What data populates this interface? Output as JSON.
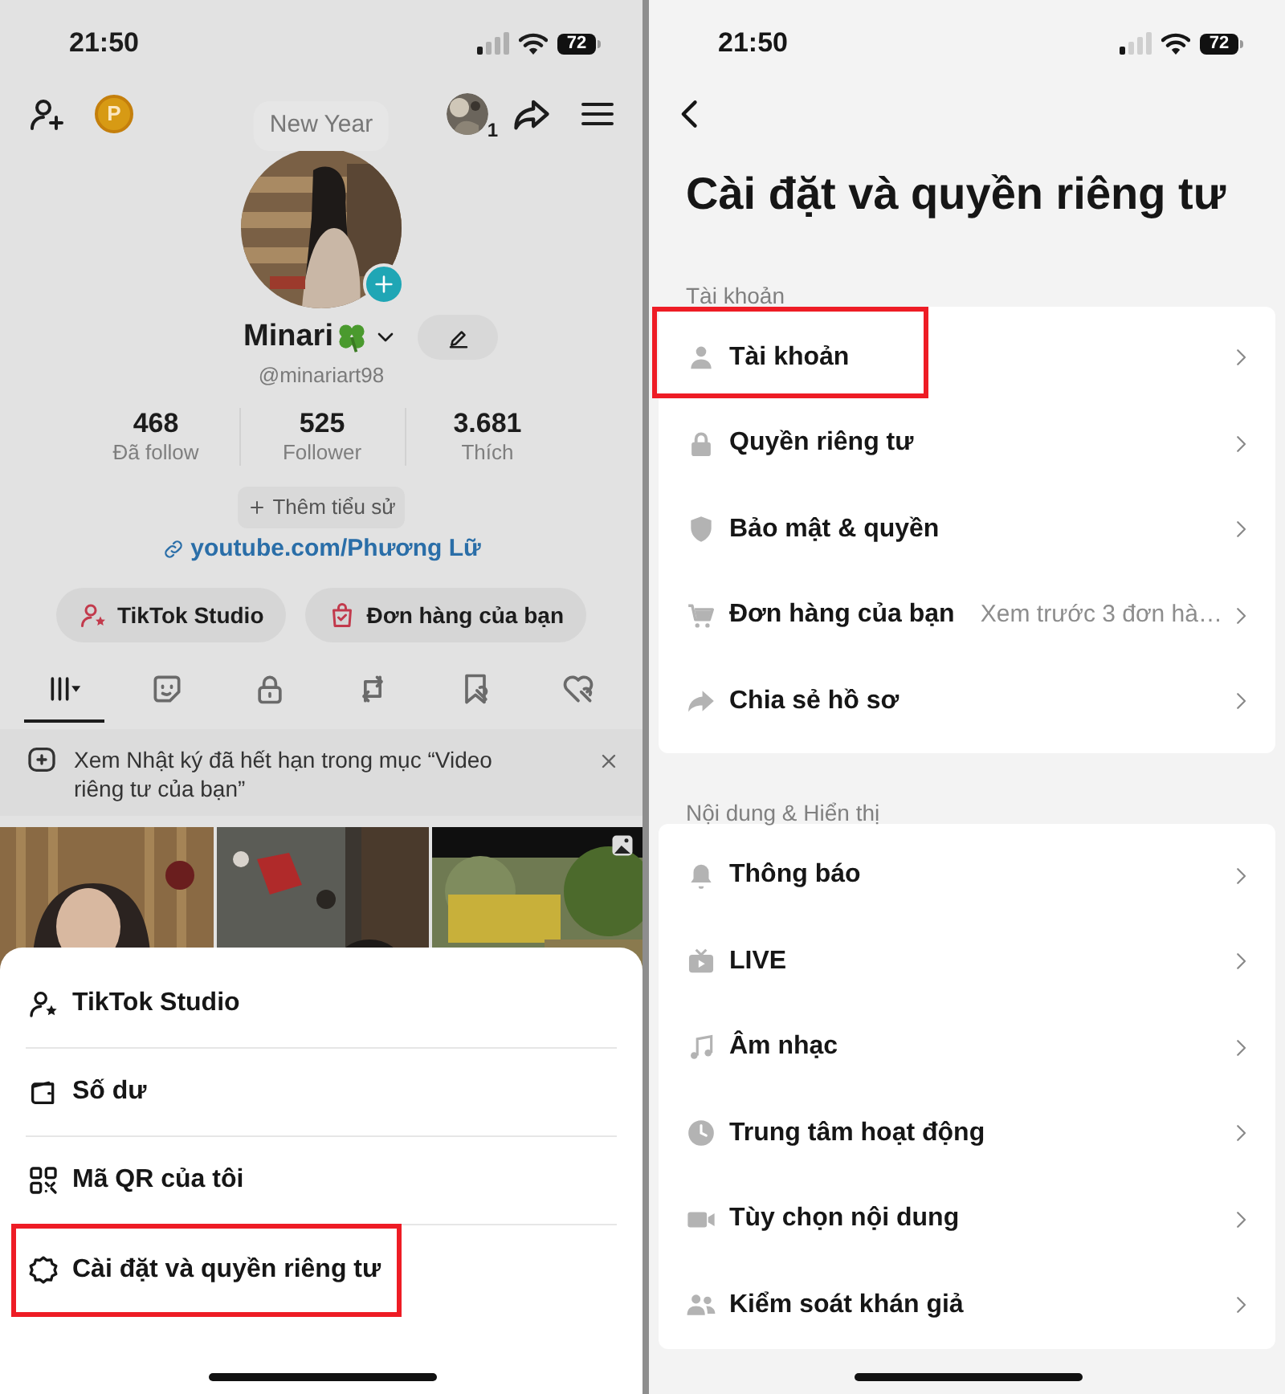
{
  "left_screen": {
    "status_bar": {
      "time": "21:50",
      "battery": "72"
    },
    "top_bar": {
      "points_badge": "P",
      "notification_count": "1"
    },
    "profile": {
      "status_bubble": "New Year",
      "name": "Minari",
      "handle": "@minariart98",
      "stats": [
        {
          "value": "468",
          "label": "Đã follow"
        },
        {
          "value": "525",
          "label": "Follower"
        },
        {
          "value": "3.681",
          "label": "Thích"
        }
      ],
      "bio_button": "Thêm tiểu sử",
      "link": "youtube.com/Phương Lữ",
      "buttons": [
        {
          "kind": "studio",
          "label": "TikTok Studio"
        },
        {
          "kind": "orders",
          "label": "Đơn hàng của bạn"
        }
      ]
    },
    "tabs": [
      {
        "kind": "videos",
        "selected": true
      },
      {
        "kind": "stickers",
        "selected": false
      },
      {
        "kind": "private",
        "selected": false
      },
      {
        "kind": "reposts",
        "selected": false
      },
      {
        "kind": "favorites",
        "selected": false
      },
      {
        "kind": "liked",
        "selected": false
      }
    ],
    "notice": "Xem Nhật ký đã hết hạn trong mục “Video riêng tư của bạn”",
    "menu_sheet": [
      {
        "kind": "studio",
        "label": "TikTok Studio",
        "highlighted": false
      },
      {
        "kind": "balance",
        "label": "Số dư",
        "highlighted": false
      },
      {
        "kind": "qr",
        "label": "Mã QR của tôi",
        "highlighted": false
      },
      {
        "kind": "settings",
        "label": "Cài đặt và quyền riêng tư",
        "highlighted": true
      }
    ]
  },
  "right_screen": {
    "status_bar": {
      "time": "21:50",
      "battery": "72"
    },
    "title": "Cài đặt và quyền riêng tư",
    "sections": [
      {
        "heading": "Tài khoản",
        "items": [
          {
            "kind": "account",
            "label": "Tài khoản",
            "highlighted": true
          },
          {
            "kind": "privacy",
            "label": "Quyền riêng tư",
            "highlighted": false
          },
          {
            "kind": "security",
            "label": "Bảo mật & quyền",
            "highlighted": false
          },
          {
            "kind": "orders",
            "label": "Đơn hàng của bạn",
            "detail": "Xem trước 3 đơn hà…",
            "highlighted": false
          },
          {
            "kind": "share",
            "label": "Chia sẻ hồ sơ",
            "highlighted": false
          }
        ]
      },
      {
        "heading": "Nội dung & Hiển thị",
        "items": [
          {
            "kind": "notifications",
            "label": "Thông báo",
            "highlighted": false
          },
          {
            "kind": "live",
            "label": "LIVE",
            "highlighted": false
          },
          {
            "kind": "music",
            "label": "Âm nhạc",
            "highlighted": false
          },
          {
            "kind": "activity",
            "label": "Trung tâm hoạt động",
            "highlighted": false
          },
          {
            "kind": "content",
            "label": "Tùy chọn nội dung",
            "highlighted": false
          },
          {
            "kind": "audience",
            "label": "Kiểm soát khán giả",
            "highlighted": false
          }
        ]
      }
    ]
  }
}
